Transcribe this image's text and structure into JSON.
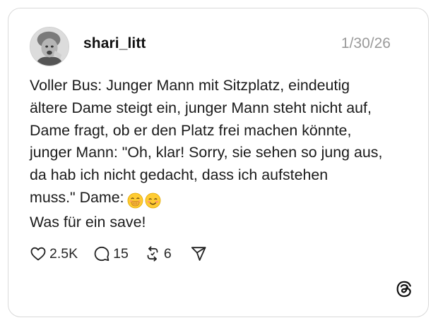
{
  "post": {
    "username": "shari_litt",
    "date": "1/30/26",
    "lines": [
      "Voller Bus: Junger Mann mit Sitzplatz, eindeutig",
      "ältere Dame steigt ein, junger Mann steht nicht auf,",
      "Dame fragt, ob er den Platz frei machen könnte,",
      "junger Mann: \"Oh, klar! Sorry, sie sehen so jung aus,",
      "da hab ich nicht gedacht, dass ich aufstehen",
      "muss.\" Dame:",
      "Was für ein save!"
    ],
    "emojis": [
      "face-with-hand-over-mouth",
      "smiling-face-with-blushing-cheeks"
    ]
  },
  "actions": {
    "likes": "2.5K",
    "replies": "15",
    "reposts": "6"
  },
  "icons": {
    "like": "heart-icon",
    "reply": "speech-bubble-icon",
    "repost": "repost-icon",
    "share": "send-icon",
    "brand": "threads-logo"
  },
  "colors": {
    "text": "#1a1a1a",
    "muted": "#9a9a9a",
    "border": "#d9d9d9"
  }
}
